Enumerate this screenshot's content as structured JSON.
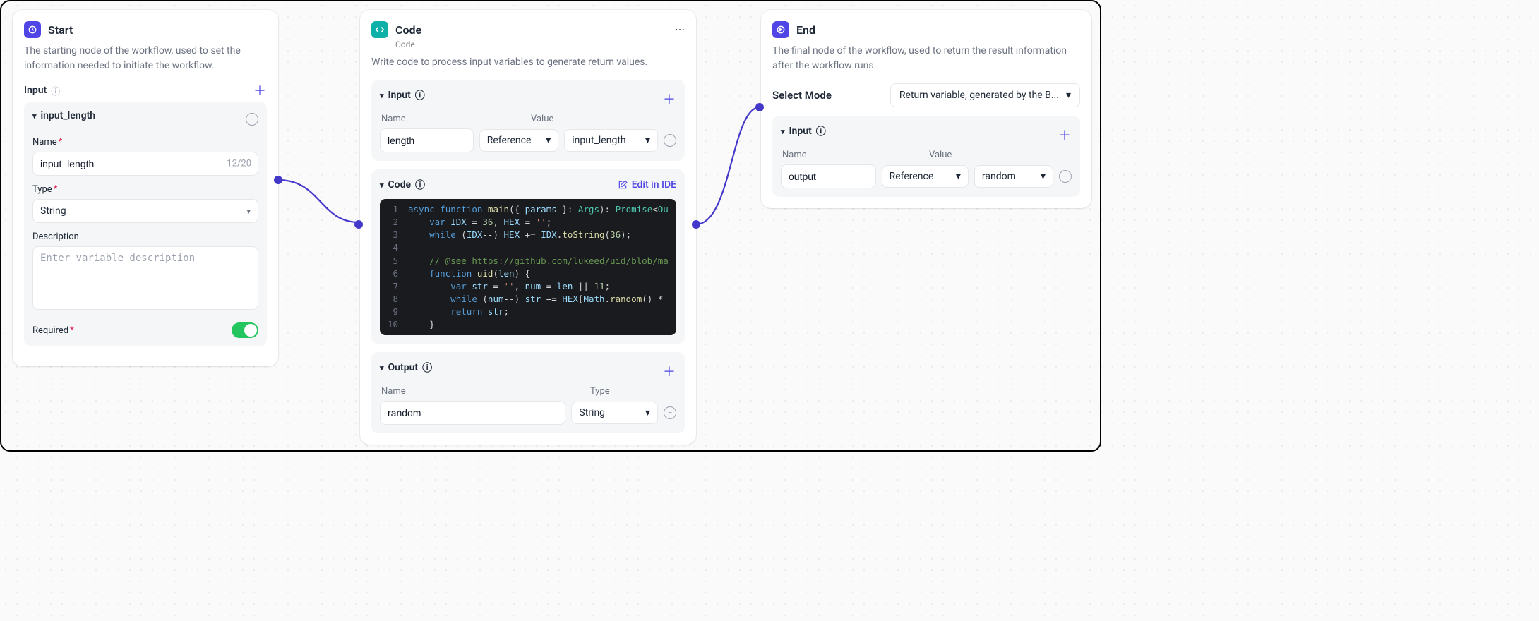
{
  "start": {
    "title": "Start",
    "description": "The starting node of the workflow, used to set the information needed to initiate the workflow.",
    "input_label": "Input",
    "var": {
      "name_label": "input_length",
      "field_name_label": "Name",
      "name_value": "input_length",
      "name_counter": "12/20",
      "type_label": "Type",
      "type_value": "String",
      "desc_label": "Description",
      "desc_placeholder": "Enter variable description",
      "required_label": "Required"
    }
  },
  "code": {
    "title": "Code",
    "subtitle": "Code",
    "description": "Write code to process input variables to generate return values.",
    "input_label": "Input",
    "th_name": "Name",
    "th_value": "Value",
    "input_name": "length",
    "input_ref": "Reference",
    "input_var": "input_length",
    "code_label": "Code",
    "edit_ide": "Edit in IDE",
    "lines": {
      "l1_async": "async",
      "l1_function": "function",
      "l1_main": "main",
      "l1_params": "params",
      "l1_args": "Args",
      "l1_promise": "Promise",
      "l1_out": "Ou",
      "l2_var": "var",
      "l2_idx": "IDX",
      "l2_36": "36",
      "l2_hex": "HEX",
      "l2_empty": "''",
      "l3_while": "while",
      "l3_idx": "IDX",
      "l3_hex": "HEX",
      "l3_idx2": "IDX",
      "l3_tostr": "toString",
      "l3_36": "36",
      "l5_comment": "// @see ",
      "l5_url": "https://github.com/lukeed/uid/blob/ma",
      "l6_function": "function",
      "l6_uid": "uid",
      "l6_len": "len",
      "l7_var": "var",
      "l7_str": "str",
      "l7_empty": "''",
      "l7_num": "num",
      "l7_len": "len",
      "l7_11": "11",
      "l8_while": "while",
      "l8_num": "num",
      "l8_str": "str",
      "l8_hex": "HEX",
      "l8_math": "Math",
      "l8_rand": "random",
      "l9_return": "return",
      "l9_str": "str"
    },
    "output_label": "Output",
    "out_th_name": "Name",
    "out_th_type": "Type",
    "output_name": "random",
    "output_type": "String"
  },
  "end": {
    "title": "End",
    "description": "The final node of the workflow, used to return the result information after the workflow runs.",
    "mode_label": "Select Mode",
    "mode_value": "Return variable, generated by the B...",
    "input_label": "Input",
    "th_name": "Name",
    "th_value": "Value",
    "input_name": "output",
    "input_ref": "Reference",
    "input_var": "random"
  }
}
